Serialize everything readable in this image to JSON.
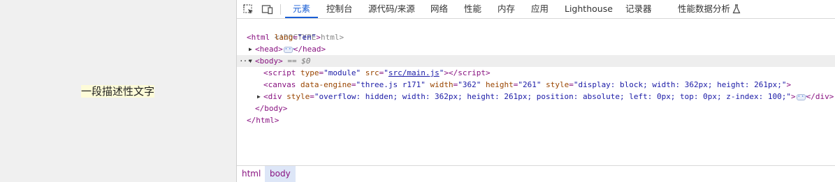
{
  "viewport": {
    "description_text": "一段描述性文字"
  },
  "devtools": {
    "tabs": [
      "元素",
      "控制台",
      "源代码/来源",
      "网络",
      "性能",
      "内存",
      "应用",
      "Lighthouse",
      "记录器",
      "性能数据分析"
    ],
    "active_tab": "元素",
    "dom": {
      "doctype": "<!DOCTYPE html>",
      "html_open_tag": "html",
      "html_lang_attr": "lang",
      "html_lang_val": "\"en\"",
      "head_tag": "head",
      "body_tag": "body",
      "body_selected_marker": "== $0",
      "script_tag": "script",
      "script_type_attr": "type",
      "script_type_val": "\"module\"",
      "script_src_attr": "src",
      "script_src_val": "src/main.js",
      "canvas_tag": "canvas",
      "canvas_engine_attr": "data-engine",
      "canvas_engine_val": "\"three.js r171\"",
      "canvas_width_attr": "width",
      "canvas_width_val": "\"362\"",
      "canvas_height_attr": "height",
      "canvas_height_val": "\"261\"",
      "canvas_style_attr": "style",
      "canvas_style_val": "\"display: block; width: 362px; height: 261px;\"",
      "div_tag": "div",
      "div_style_attr": "style",
      "div_style_val": "\"overflow: hidden; width: 362px; height: 261px; position: absolute; left: 0px; top: 0px; z-index: 100;\"",
      "ellipsis": "···"
    },
    "breadcrumb": [
      "html",
      "body"
    ],
    "breadcrumb_active": "body",
    "icons": {
      "inspect": "inspect-element-icon",
      "device": "device-toolbar-icon",
      "flask": "flask-icon"
    }
  }
}
